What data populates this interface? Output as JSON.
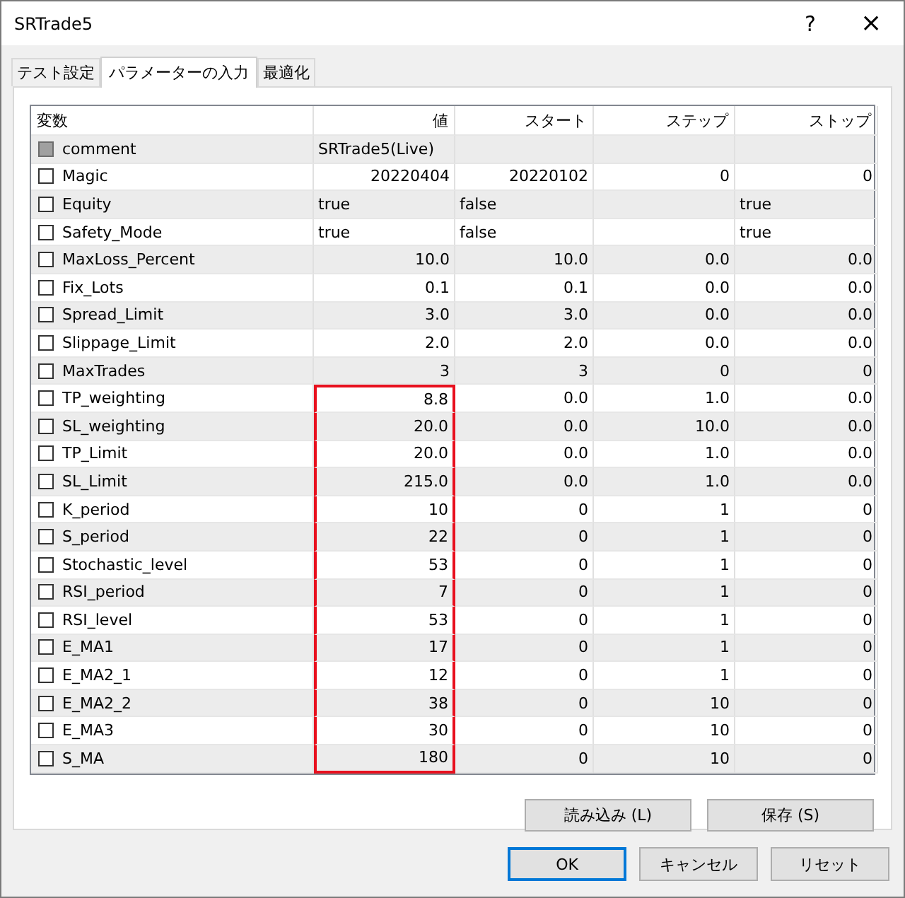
{
  "window": {
    "title": "SRTrade5",
    "help": "?",
    "close": "×"
  },
  "tabs": [
    {
      "label": "テスト設定",
      "selected": false
    },
    {
      "label": "パラメーターの入力",
      "selected": true
    },
    {
      "label": "最適化",
      "selected": false
    }
  ],
  "table": {
    "columns": [
      "変数",
      "値",
      "スタート",
      "ステップ",
      "ストップ"
    ],
    "rows": [
      {
        "name": "comment",
        "checked": false,
        "disabled": true,
        "highlighted": false,
        "kind": "text",
        "value": "SRTrade5(Live)",
        "start": "",
        "step": "",
        "stop": ""
      },
      {
        "name": "Magic",
        "checked": false,
        "disabled": false,
        "highlighted": false,
        "kind": "number",
        "value": "20220404",
        "start": "20220102",
        "step": "0",
        "stop": "0"
      },
      {
        "name": "Equity",
        "checked": false,
        "disabled": false,
        "highlighted": false,
        "kind": "text",
        "value": "true",
        "start": "false",
        "step": "",
        "stop": "true"
      },
      {
        "name": "Safety_Mode",
        "checked": false,
        "disabled": false,
        "highlighted": false,
        "kind": "text",
        "value": "true",
        "start": "false",
        "step": "",
        "stop": "true"
      },
      {
        "name": "MaxLoss_Percent",
        "checked": false,
        "disabled": false,
        "highlighted": false,
        "kind": "number",
        "value": "10.0",
        "start": "10.0",
        "step": "0.0",
        "stop": "0.0"
      },
      {
        "name": "Fix_Lots",
        "checked": false,
        "disabled": false,
        "highlighted": false,
        "kind": "number",
        "value": "0.1",
        "start": "0.1",
        "step": "0.0",
        "stop": "0.0"
      },
      {
        "name": "Spread_Limit",
        "checked": false,
        "disabled": false,
        "highlighted": false,
        "kind": "number",
        "value": "3.0",
        "start": "3.0",
        "step": "0.0",
        "stop": "0.0"
      },
      {
        "name": "Slippage_Limit",
        "checked": false,
        "disabled": false,
        "highlighted": false,
        "kind": "number",
        "value": "2.0",
        "start": "2.0",
        "step": "0.0",
        "stop": "0.0"
      },
      {
        "name": "MaxTrades",
        "checked": false,
        "disabled": false,
        "highlighted": false,
        "kind": "number",
        "value": "3",
        "start": "3",
        "step": "0",
        "stop": "0"
      },
      {
        "name": "TP_weighting",
        "checked": false,
        "disabled": false,
        "highlighted": true,
        "kind": "number",
        "value": "8.8",
        "start": "0.0",
        "step": "1.0",
        "stop": "0.0"
      },
      {
        "name": "SL_weighting",
        "checked": false,
        "disabled": false,
        "highlighted": true,
        "kind": "number",
        "value": "20.0",
        "start": "0.0",
        "step": "10.0",
        "stop": "0.0"
      },
      {
        "name": "TP_Limit",
        "checked": false,
        "disabled": false,
        "highlighted": true,
        "kind": "number",
        "value": "20.0",
        "start": "0.0",
        "step": "1.0",
        "stop": "0.0"
      },
      {
        "name": "SL_Limit",
        "checked": false,
        "disabled": false,
        "highlighted": true,
        "kind": "number",
        "value": "215.0",
        "start": "0.0",
        "step": "1.0",
        "stop": "0.0"
      },
      {
        "name": "K_period",
        "checked": false,
        "disabled": false,
        "highlighted": true,
        "kind": "number",
        "value": "10",
        "start": "0",
        "step": "1",
        "stop": "0"
      },
      {
        "name": "S_period",
        "checked": false,
        "disabled": false,
        "highlighted": true,
        "kind": "number",
        "value": "22",
        "start": "0",
        "step": "1",
        "stop": "0"
      },
      {
        "name": "Stochastic_level",
        "checked": false,
        "disabled": false,
        "highlighted": true,
        "kind": "number",
        "value": "53",
        "start": "0",
        "step": "1",
        "stop": "0"
      },
      {
        "name": "RSI_period",
        "checked": false,
        "disabled": false,
        "highlighted": true,
        "kind": "number",
        "value": "7",
        "start": "0",
        "step": "1",
        "stop": "0"
      },
      {
        "name": "RSI_level",
        "checked": false,
        "disabled": false,
        "highlighted": true,
        "kind": "number",
        "value": "53",
        "start": "0",
        "step": "1",
        "stop": "0"
      },
      {
        "name": "E_MA1",
        "checked": false,
        "disabled": false,
        "highlighted": true,
        "kind": "number",
        "value": "17",
        "start": "0",
        "step": "1",
        "stop": "0"
      },
      {
        "name": "E_MA2_1",
        "checked": false,
        "disabled": false,
        "highlighted": true,
        "kind": "number",
        "value": "12",
        "start": "0",
        "step": "1",
        "stop": "0"
      },
      {
        "name": "E_MA2_2",
        "checked": false,
        "disabled": false,
        "highlighted": true,
        "kind": "number",
        "value": "38",
        "start": "0",
        "step": "10",
        "stop": "0"
      },
      {
        "name": "E_MA3",
        "checked": false,
        "disabled": false,
        "highlighted": true,
        "kind": "number",
        "value": "30",
        "start": "0",
        "step": "10",
        "stop": "0"
      },
      {
        "name": "S_MA",
        "checked": false,
        "disabled": false,
        "highlighted": true,
        "kind": "number",
        "value": "180",
        "start": "0",
        "step": "10",
        "stop": "0"
      }
    ]
  },
  "file_buttons": [
    "読み込み (L)",
    "保存 (S)"
  ],
  "dialog_buttons": [
    {
      "label": "OK",
      "default": true
    },
    {
      "label": "キャンセル",
      "default": false
    },
    {
      "label": "リセット",
      "default": false
    }
  ]
}
